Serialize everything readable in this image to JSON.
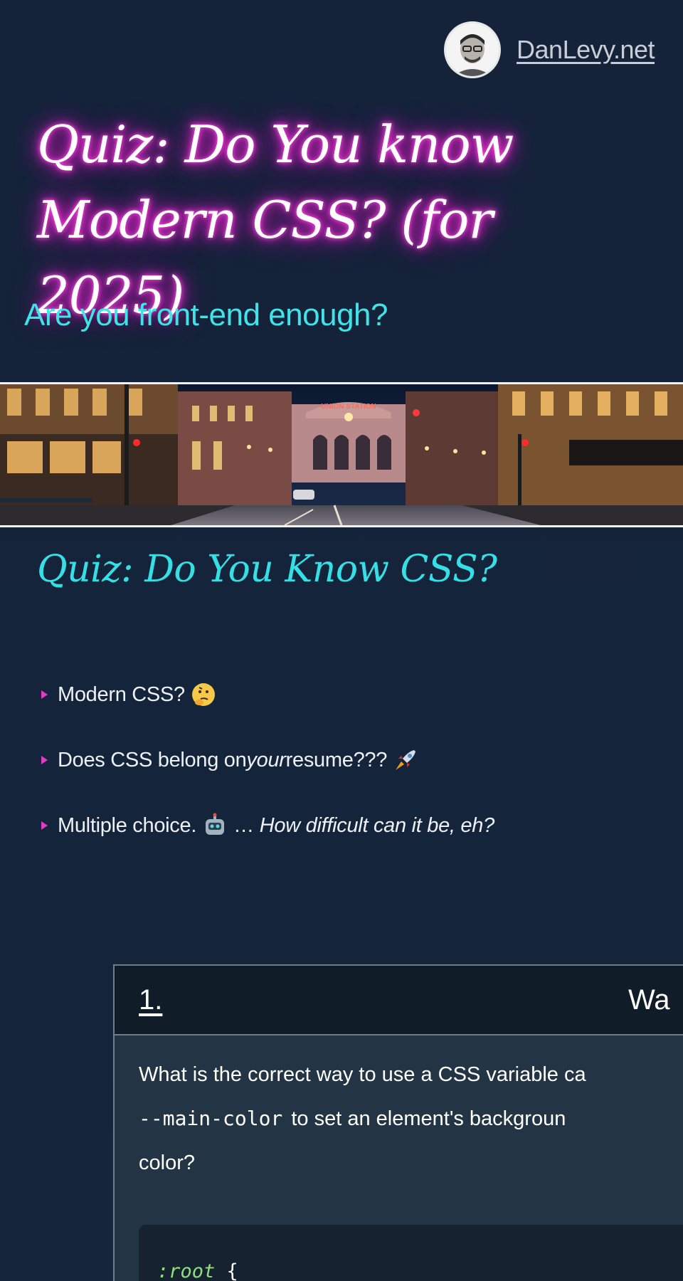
{
  "header": {
    "site_link": "DanLevy.net",
    "avatar_icon": "user-avatar"
  },
  "hero": {
    "title": "Quiz: Do You know Modern CSS? (for 2025)",
    "subtitle": "Are you front-end enough?",
    "banner_sign": "UNION STATION"
  },
  "section": {
    "title": "Quiz: Do You Know CSS?",
    "bullets": [
      {
        "text": "Modern CSS?",
        "emoji": "thinking-face-emoji"
      },
      {
        "text_before": "Does CSS belong on ",
        "text_em": "your",
        "text_after": " resume???",
        "emoji": "rocket-emoji"
      },
      {
        "text": "Multiple choice.",
        "emoji": "robot-emoji",
        "text_ellipsis": "…",
        "text_em": "How difficult can it be, eh?"
      }
    ]
  },
  "quiz": {
    "number": "1.",
    "heading_fragment": "Wa",
    "question_line1": "What is the correct way to use a CSS variable ca",
    "question_code": "--main-color",
    "question_line2_rest": "to set an element's backgroun",
    "question_line3": "color?",
    "code_selector": ":root",
    "code_brace": " {"
  },
  "colors": {
    "background": "#14243a",
    "neon_pink": "#ff2fdc",
    "cyan": "#3fe3e8",
    "bullet_marker": "#e23cc3"
  }
}
